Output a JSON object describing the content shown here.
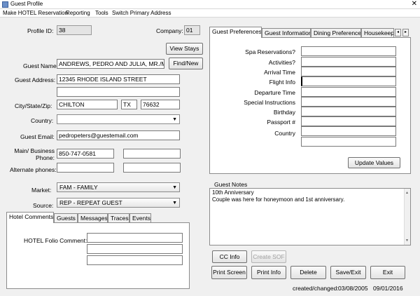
{
  "window": {
    "title": "Guest Profile",
    "close_glyph": "✕"
  },
  "menu": [
    "Make HOTEL Reservation",
    "Reporting",
    "Tools",
    "Switch Primary Address"
  ],
  "profile": {
    "profile_id_label": "Profile ID:",
    "profile_id": "38",
    "company_label": "Company:",
    "company": "01",
    "view_stays": "View Stays",
    "guest_name_label": "Guest Name:",
    "guest_name": "ANDREWS, PEDRO AND JULIA, MR./MRS",
    "find_new": "Find/New",
    "guest_address_label": "Guest Address:",
    "address1": "12345 RHODE ISLAND STREET",
    "address2": "",
    "city_label": "City/State/Zip:",
    "city": "CHILTON",
    "state": "TX",
    "zip": "76632",
    "country_label": "Country:",
    "country": "",
    "email_label": "Guest Email:",
    "email": "pedropeters@guestemail.com",
    "main_phone_label_1": "Main/ Business",
    "main_phone_label_2": "Phone:",
    "main_phone": "850-747-0581",
    "business_phone": "",
    "alt_phone_label": "Alternate phones:",
    "alt_phone1": "",
    "alt_phone2": "",
    "market_label": "Market:",
    "market": "FAM  - FAMILY",
    "source_label": "Source:",
    "source": "REP  - REPEAT GUEST"
  },
  "bottom_tabs": {
    "tabs": [
      "Hotel Comments",
      "Guests",
      "Messages",
      "Traces",
      "Events"
    ],
    "folio_label": "HOTEL Folio Comment:",
    "folio1": "",
    "folio2": "",
    "folio3": ""
  },
  "prefs": {
    "tabs": [
      "Guest Preferences",
      "Guest Information",
      "Dining Preferences",
      "Housekeep"
    ],
    "scroll_left": "◂",
    "scroll_right": "▸",
    "fields": [
      {
        "label": "Spa Reservations?",
        "value": ""
      },
      {
        "label": "Activities?",
        "value": ""
      },
      {
        "label": "Arrival Time",
        "value": ""
      },
      {
        "label": "Flight Info",
        "value": ""
      },
      {
        "label": "Departure Time",
        "value": ""
      },
      {
        "label": "Special Instructions",
        "value": ""
      },
      {
        "label": "Birthday",
        "value": ""
      },
      {
        "label": "Passport #",
        "value": ""
      },
      {
        "label": "Country",
        "value": ""
      },
      {
        "label": "",
        "value": ""
      }
    ],
    "update": "Update Values"
  },
  "notes": {
    "label": "Guest Notes",
    "line1": "10th Anniversary",
    "line2": "Couple was here for honeymoon and 1st anniversary."
  },
  "actions": {
    "cc_info": "CC Info",
    "create_sof": "Create SOF",
    "print_screen": "Print Screen",
    "print_info": "Print Info",
    "delete": "Delete",
    "save_exit": "Save/Exit",
    "exit": "Exit"
  },
  "footer": {
    "label": "created/changed:",
    "created": "03/08/2005",
    "changed": "09/01/2016"
  }
}
